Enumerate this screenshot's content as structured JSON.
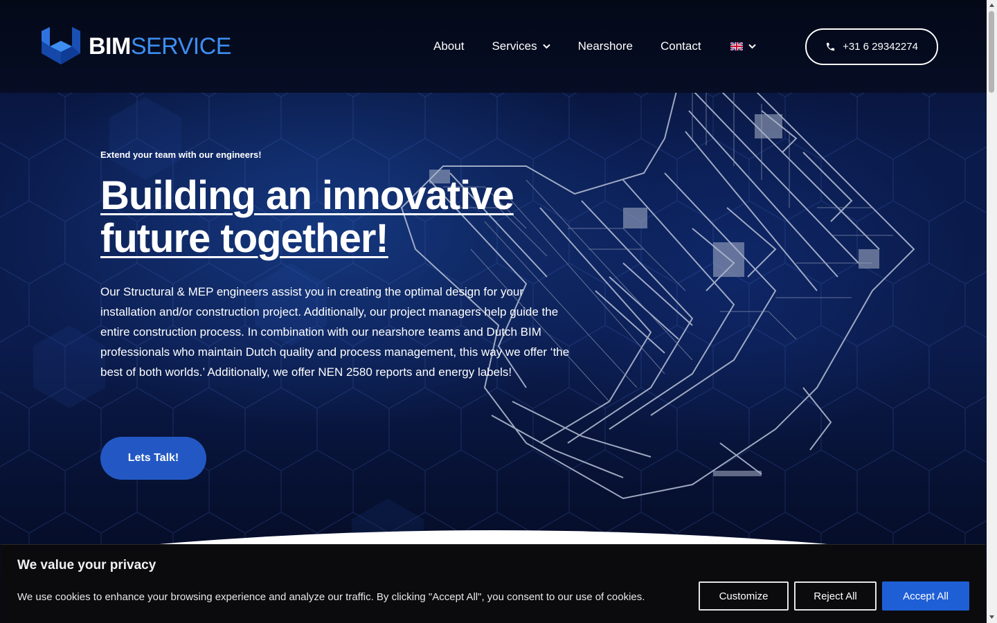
{
  "header": {
    "logo": {
      "part1": "BIM",
      "part2": "SERVICE"
    },
    "nav": [
      {
        "label": "About",
        "has_dropdown": false
      },
      {
        "label": "Services",
        "has_dropdown": true
      },
      {
        "label": "Nearshore",
        "has_dropdown": false
      },
      {
        "label": "Contact",
        "has_dropdown": false
      }
    ],
    "language": {
      "icon": "uk-flag-icon",
      "has_dropdown": true
    },
    "phone": {
      "label": "+31 6 29342274",
      "icon": "phone-icon"
    }
  },
  "hero": {
    "eyebrow": "Extend your team with our engineers!",
    "headline": "Building an innovative future together!",
    "body": "Our Structural & MEP engineers assist you in creating the optimal design for your installation and/or construction project. Additionally, our project managers help guide the entire construction process. In combination with our nearshore teams and Dutch BIM professionals who maintain Dutch quality and process management, this way we offer ‘the best of both worlds.’  Additionally, we offer NEN 2580 reports and energy labels!",
    "cta_label": "Lets Talk!"
  },
  "cookie_banner": {
    "title": "We value your privacy",
    "text": "We use cookies to enhance your browsing experience and analyze our traffic. By clicking \"Accept All\", you consent to our use of cookies.",
    "buttons": {
      "customize": "Customize",
      "reject": "Reject All",
      "accept": "Accept All"
    }
  },
  "colors": {
    "brand_blue": "#3d8ef0",
    "cta_blue": "#2358c4",
    "accept_blue": "#1f5fd6",
    "header_bg": "#050b20",
    "banner_bg": "#0b0b0d"
  }
}
